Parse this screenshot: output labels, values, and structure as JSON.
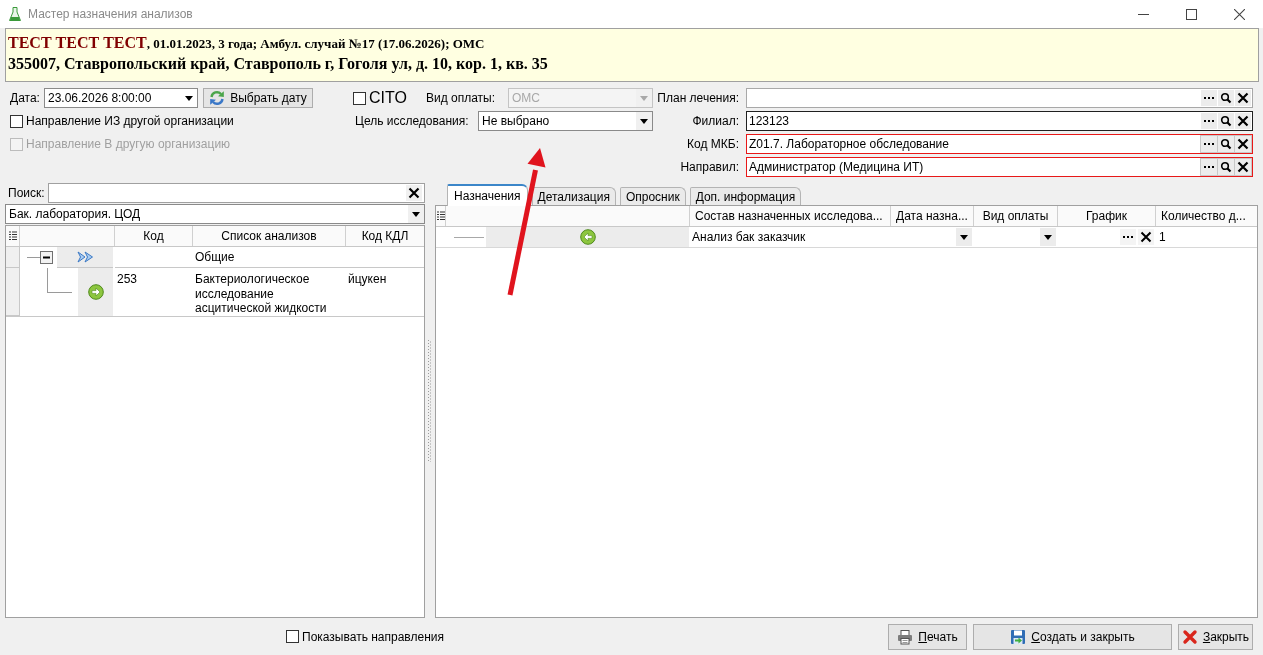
{
  "window": {
    "title": "Мастер назначения анализов"
  },
  "patient_header": {
    "name": "ТЕСТ ТЕСТ ТЕСТ",
    "details": ", 01.01.2023, 3 года; Амбул. случай №17 (17.06.2026); ОМС",
    "address": "355007, Ставропольский край, Ставрополь г, Гоголя ул, д. 10, кор. 1, кв. 35"
  },
  "form": {
    "date": {
      "label": "Дата:",
      "value": "23.06.2026 8:00:00"
    },
    "pick_date_button": {
      "label": "Выбрать дату"
    },
    "cito": {
      "label": "CITO",
      "checked": false
    },
    "payment_type": {
      "label": "Вид оплаты:",
      "value": "ОМС",
      "disabled": true
    },
    "purpose": {
      "label": "Цель исследования:",
      "value": "Не выбрано"
    },
    "referrals": [
      {
        "label": "Направление ИЗ другой организации",
        "checked": false,
        "disabled": false
      },
      {
        "label": "Направление В другую организацию",
        "checked": false,
        "disabled": true
      }
    ],
    "lookups": [
      {
        "label": "План лечения:",
        "required": false,
        "focused": false
      },
      {
        "label": "Филиал:",
        "value": "123123",
        "required": false,
        "focused": true
      },
      {
        "label": "Код МКБ:",
        "value": "Z01.7. Лабораторное обследование",
        "required": true,
        "focused": false
      },
      {
        "label": "Направил:",
        "value": "Администратор (Медицина ИТ)",
        "required": true,
        "focused": false
      }
    ]
  },
  "analysis_catalog": {
    "search": {
      "label": "Поиск:"
    },
    "laboratory": {
      "value": "Бак. лаборатория. ЦОД"
    },
    "columns": [
      "Код",
      "Список анализов",
      "Код КДЛ"
    ],
    "rows": [
      {
        "kind": "group",
        "name": "Общие",
        "expanded": true,
        "children": [
          {
            "kind": "analysis",
            "code": "253",
            "name": "Бактериологическое исследование асцитической жидкости",
            "kdl_code": "йцукен"
          }
        ]
      }
    ]
  },
  "assignments": {
    "tabs": [
      {
        "label": "Назначения",
        "selected": true
      },
      {
        "label": "Детализация",
        "selected": false
      },
      {
        "label": "Опросник",
        "selected": false
      },
      {
        "label": "Доп. информация",
        "selected": false
      }
    ],
    "columns": [
      "Состав назначенных исследова...",
      "Дата назна...",
      "Вид оплаты",
      "График",
      "Количество д..."
    ],
    "rows": [
      {
        "name": "Анализ бак заказчик",
        "quantity": "1"
      }
    ]
  },
  "footer": {
    "show_referrals": {
      "label": "Показывать направления",
      "checked": false
    },
    "buttons": [
      {
        "label": "Печать",
        "kind": "print"
      },
      {
        "label": "Создать и закрыть",
        "kind": "save"
      },
      {
        "label": "Закрыть",
        "kind": "close"
      }
    ]
  }
}
